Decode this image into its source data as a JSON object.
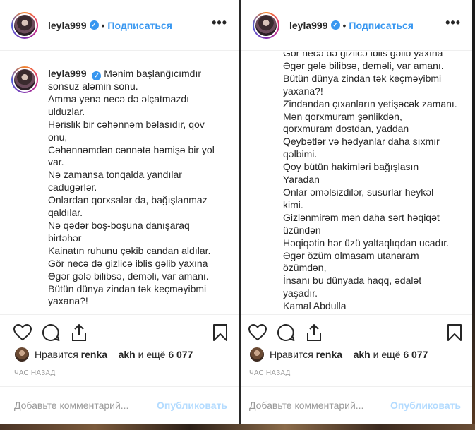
{
  "post": {
    "username": "leyla999",
    "verified_glyph": "✓",
    "separator": "•",
    "follow_label": "Подписаться",
    "more_label": "•••"
  },
  "caption_lines_left": [
    "Mənim başlanğıcımdır",
    "sonsuz aləmin sonu.",
    "Amma yenə necə də əlçatmazdı",
    "ulduzlar.",
    "Hərislik bir cəhənnəm bəlasıdır, qov",
    "onu,",
    "Cəhənnəmdən cənnətə həmişə bir yol",
    "var.",
    "Nə zamansa tonqalda yandılar",
    "cadugərlər.",
    "Onlardan qorxsalar da, bağışlanmaz",
    "qaldılar.",
    "Nə qədər boş-boşuna danışaraq",
    "birtəhər",
    "Kainatın ruhunu çəkib candan aldılar.",
    "Gör necə də gizlicə iblis gəlib yaxına",
    "Əgər gələ bilibsə, deməli, var amanı.",
    "Bütün dünya zindan tək keçməyibmi",
    "yaxana?!"
  ],
  "caption_lines_right": [
    "Gör necə də gizlicə iblis gəlib yaxına",
    "Əgər gələ bilibsə, deməli, var amanı.",
    "Bütün dünya zindan tək keçməyibmi",
    "yaxana?!",
    "Zindandan çıxanların yetişəcək zamanı.",
    "Mən qorxmuram şənlikdən,",
    "qorxmuram dostdan, yaddan",
    "Qeybətlər və hədyanlar daha sıxmır",
    "qəlbimi.",
    "Qoy bütün hakimləri bağışlasın",
    "Yaradan",
    "Onlar əməlsizdilər, susurlar heykəl",
    "kimi.",
    "Gizlənmirəm mən daha sərt həqiqət",
    "üzündən",
    "Həqiqətin hər üzü yaltaqlıqdan ucadır.",
    "Əgər özüm olmasam utanaram",
    "özümdən,",
    "İnsanı bu dünyada haqq, ədalət",
    "yaşadır.",
    "Kamal Abdulla"
  ],
  "likes": {
    "prefix": "Нравится ",
    "user": "renka__akh",
    "middle": " и ещё ",
    "count": "6 077"
  },
  "time_label": "ЧАС НАЗАД",
  "add_comment": {
    "placeholder": "Добавьте комментарий...",
    "publish_label": "Опубликовать"
  },
  "icons": [
    "heart-icon",
    "comment-icon",
    "share-icon",
    "bookmark-icon",
    "more-icon",
    "verified-icon"
  ],
  "colors": {
    "accent": "#3897f0",
    "muted": "#999999",
    "publish_disabled": "#b3dbff",
    "text": "#262626"
  }
}
